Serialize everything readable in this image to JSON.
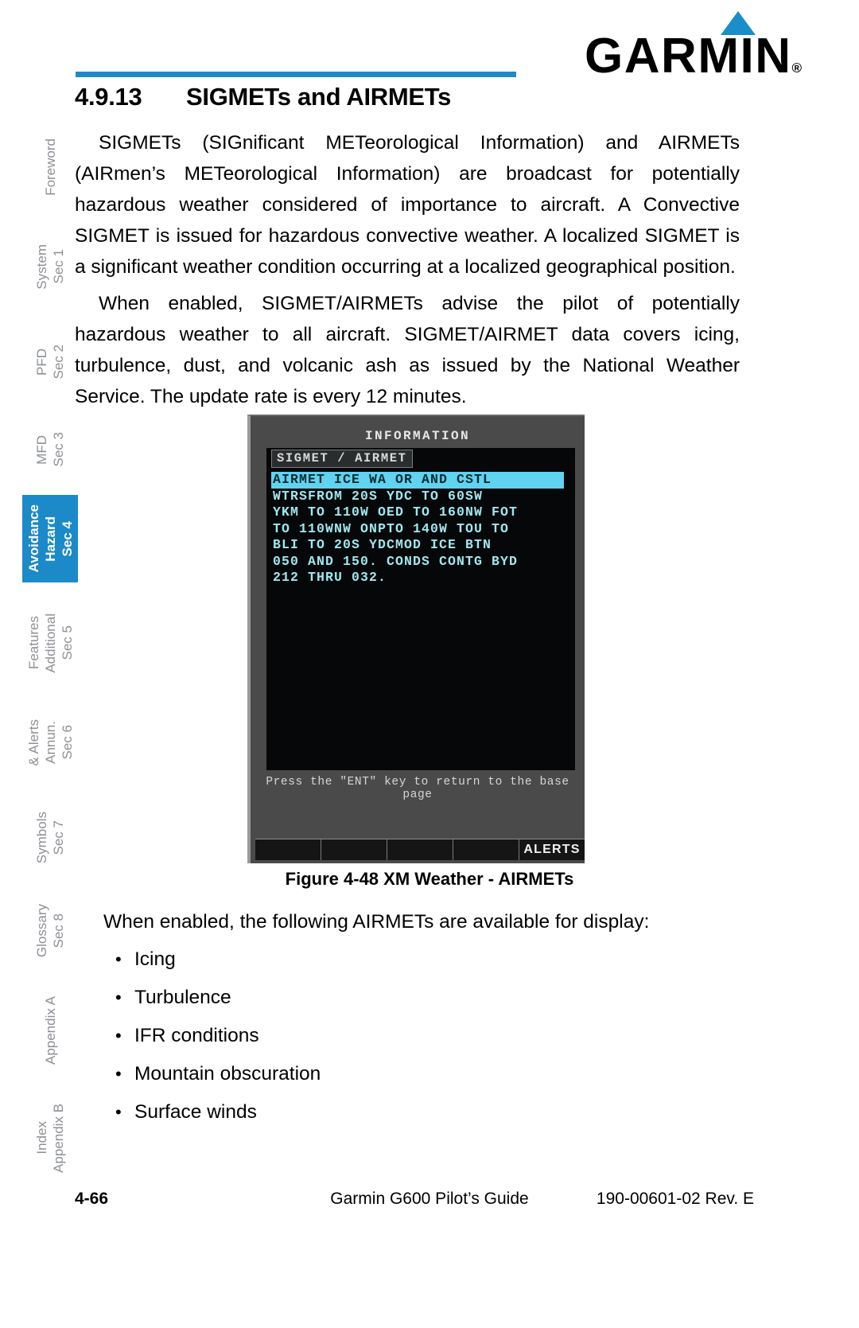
{
  "brand": {
    "name": "GARMIN",
    "registered": "®",
    "accent_color": "#1b8dc8"
  },
  "heading": {
    "number": "4.9.13",
    "title": "SIGMETs and AIRMETs"
  },
  "side_tabs": [
    {
      "line1": "",
      "line2": "Foreword",
      "active": false
    },
    {
      "line1": "Sec 1",
      "line2": "System",
      "active": false
    },
    {
      "line1": "Sec 2",
      "line2": "PFD",
      "active": false
    },
    {
      "line1": "Sec 3",
      "line2": "MFD",
      "active": false
    },
    {
      "line1": "Sec 4",
      "line2": "Hazard",
      "line3": "Avoidance",
      "active": true
    },
    {
      "line1": "Sec 5",
      "line2": "Additional",
      "line3": "Features",
      "active": false
    },
    {
      "line1": "Sec 6",
      "line2": "Annun.",
      "line3": "& Alerts",
      "active": false
    },
    {
      "line1": "Sec 7",
      "line2": "Symbols",
      "active": false
    },
    {
      "line1": "Sec 8",
      "line2": "Glossary",
      "active": false
    },
    {
      "line1": "",
      "line2": "Appendix A",
      "active": false
    },
    {
      "line1": "Appendix B",
      "line2": "Index",
      "active": false
    }
  ],
  "paragraphs": {
    "p1": "SIGMETs (SIGnificant METeorological Information) and AIRMETs (AIRmen’s METeorological Information) are broadcast for potentially hazardous weather considered of importance to aircraft. A Convective SIGMET is issued for hazardous convective weather. A localized SIGMET is a significant weather condition occurring at a localized geographical position.",
    "p2": "When enabled, SIGMET/AIRMETs advise the pilot of potentially hazardous weather to all aircraft. SIGMET/AIRMET data covers icing, turbulence, dust, and volcanic ash as issued by the National Weather Service. The update rate is every 12 minutes."
  },
  "figure": {
    "screen_title": "INFORMATION",
    "group_label": "SIGMET / AIRMET",
    "lines": [
      "AIRMET ICE WA OR AND CSTL",
      "WTRSFROM 20S YDC TO 60SW",
      "YKM TO 110W OED TO 160NW FOT",
      "TO 110WNW ONPTO 140W TOU TO",
      "BLI TO 20S YDCMOD ICE BTN",
      "050 AND 150. CONDS CONTG BYD",
      "212 THRU 032."
    ],
    "selected_index": 0,
    "hint": "Press the \"ENT\" key to return to the base page",
    "softkeys": [
      "",
      "",
      "",
      "",
      "ALERTS"
    ],
    "caption": "Figure 4-48  XM Weather - AIRMETs"
  },
  "list": {
    "intro": "When enabled, the following AIRMETs are available for display:",
    "items": [
      "Icing",
      "Turbulence",
      "IFR conditions",
      "Mountain obscuration",
      "Surface winds"
    ],
    "bullet_glyph": "•"
  },
  "footer": {
    "page_number": "4-66",
    "document_title": "Garmin G600 Pilot’s Guide",
    "part_number": "190-00601-02  Rev. E"
  }
}
